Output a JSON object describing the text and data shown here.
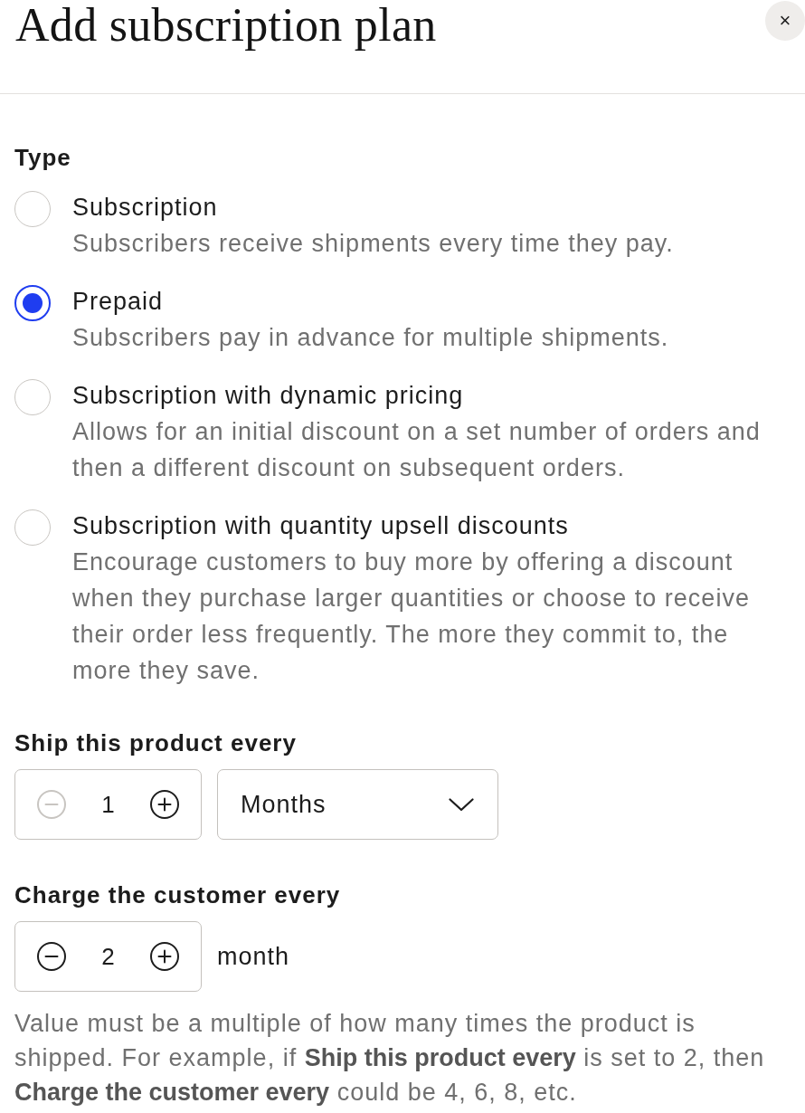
{
  "dialog": {
    "title": "Add subscription plan",
    "close_label": "×"
  },
  "type_section": {
    "label": "Type",
    "options": [
      {
        "label": "Subscription",
        "description": "Subscribers receive shipments every time they pay.",
        "selected": false
      },
      {
        "label": "Prepaid",
        "description": "Subscribers pay in advance for multiple shipments.",
        "selected": true
      },
      {
        "label": "Subscription with dynamic pricing",
        "description": "Allows for an initial discount on a set number of orders and then a different discount on subsequent orders.",
        "selected": false
      },
      {
        "label": "Subscription with quantity upsell discounts",
        "description": "Encourage customers to buy more by offering a discount when they purchase larger quantities or choose to receive their order less frequently. The more they commit to, the more they save.",
        "selected": false
      }
    ]
  },
  "ship_every": {
    "label": "Ship this product every",
    "stepper": {
      "value": "1",
      "decrement_disabled": true
    },
    "unit_select": {
      "value": "Months"
    }
  },
  "charge_every": {
    "label": "Charge the customer every",
    "stepper": {
      "value": "2",
      "decrement_disabled": false
    },
    "unit": "month"
  },
  "help_text": "Value must be a multiple of how many times the product is shipped. For example, if **Ship this product every** is set to 2, then **Charge the customer every** could be 4, 6, 8, etc."
}
